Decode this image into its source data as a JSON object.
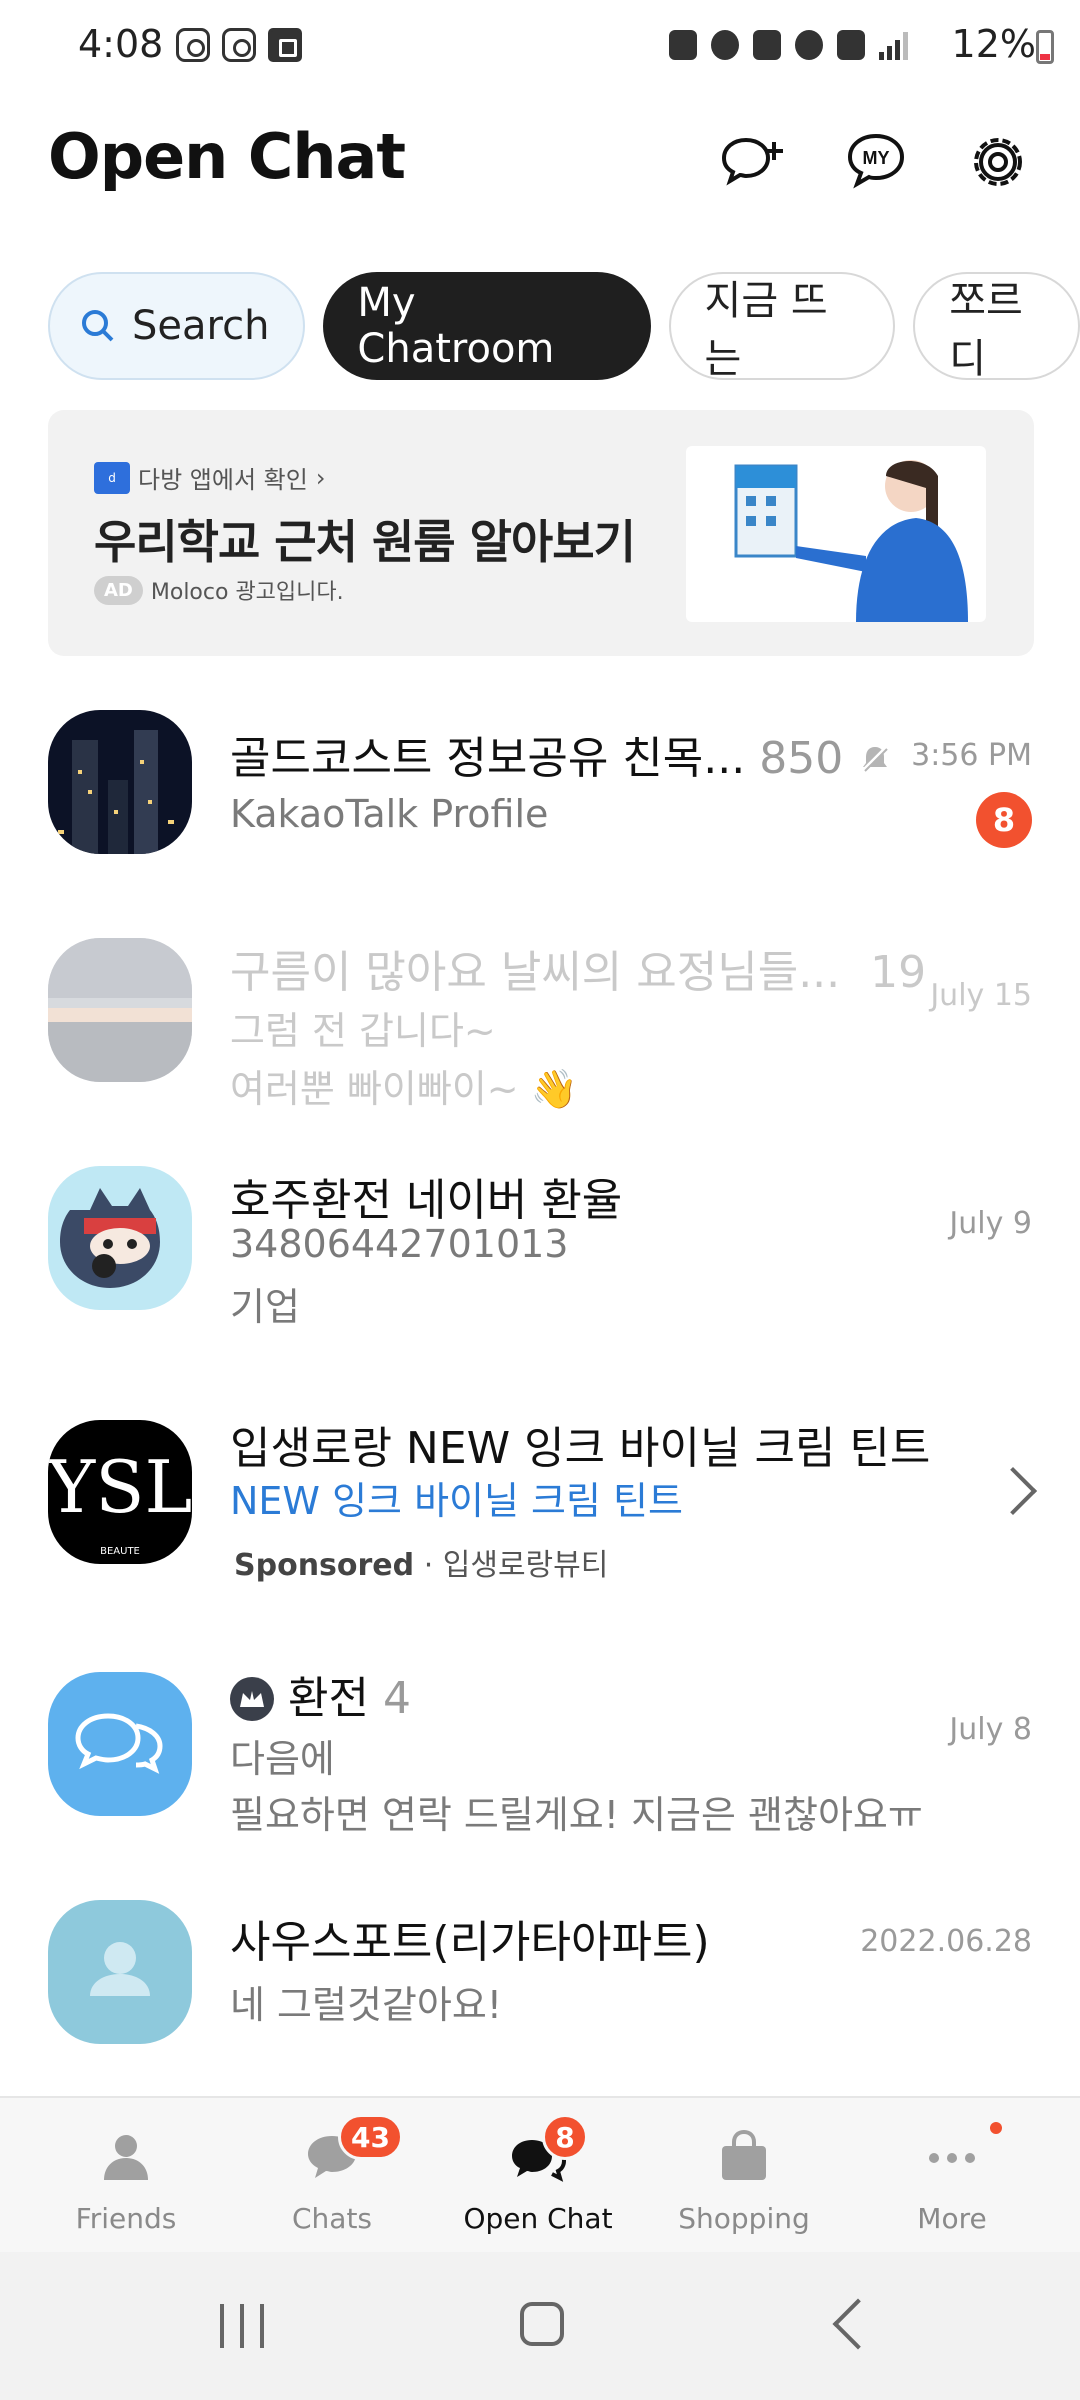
{
  "status_bar": {
    "time": "4:08",
    "battery": "12%"
  },
  "header": {
    "title": "Open Chat"
  },
  "tabs": [
    {
      "label": "Search"
    },
    {
      "label": "My Chatroom"
    },
    {
      "label": "지금 뜨는"
    },
    {
      "label": "쪼르디"
    }
  ],
  "ad": {
    "brand_text": "다방 앱에서 확인",
    "title": "우리학교 근처 원룸 알아보기",
    "badge": "AD",
    "sub": "Moloco 광고입니다."
  },
  "chats": [
    {
      "name": "골드코스트 정보공유 친목...",
      "count": "850",
      "line1": "KakaoTalk Profile",
      "time": "3:56 PM",
      "unread": "8",
      "muted": true
    },
    {
      "name": "구름이 많아요 날씨의 요정님들...",
      "count": "19",
      "line1": "그럼 전 갑니다~",
      "line2": "여러뿐 빠이빠이~ 👋",
      "time": "July 15"
    },
    {
      "name": "호주환전 네이버 환율",
      "line1": "34806442701013",
      "line2": "기업",
      "time": "July 9"
    },
    {
      "name": "입생로랑 NEW 잉크 바이닐 크림 틴트",
      "line1": "NEW 잉크 바이닐 크림 틴트",
      "sponsored": "Sponsored",
      "sponsor_name": "· 입생로랑뷰티"
    },
    {
      "name": "환전",
      "count": "4",
      "line1": "다음에",
      "line2": "필요하면 연락 드릴게요! 지금은 괜찮아요ㅠ",
      "time": "July 8"
    },
    {
      "name": "사우스포트(리가타아파트)",
      "line1": "네 그럴것같아요!",
      "time": "2022.06.28"
    }
  ],
  "bottom_nav": [
    {
      "label": "Friends"
    },
    {
      "label": "Chats",
      "badge": "43"
    },
    {
      "label": "Open Chat",
      "badge": "8"
    },
    {
      "label": "Shopping"
    },
    {
      "label": "More"
    }
  ],
  "colors": {
    "accent": "#f2512f",
    "active_tab": "#1f1f1f",
    "link_blue": "#2b7bd6"
  }
}
